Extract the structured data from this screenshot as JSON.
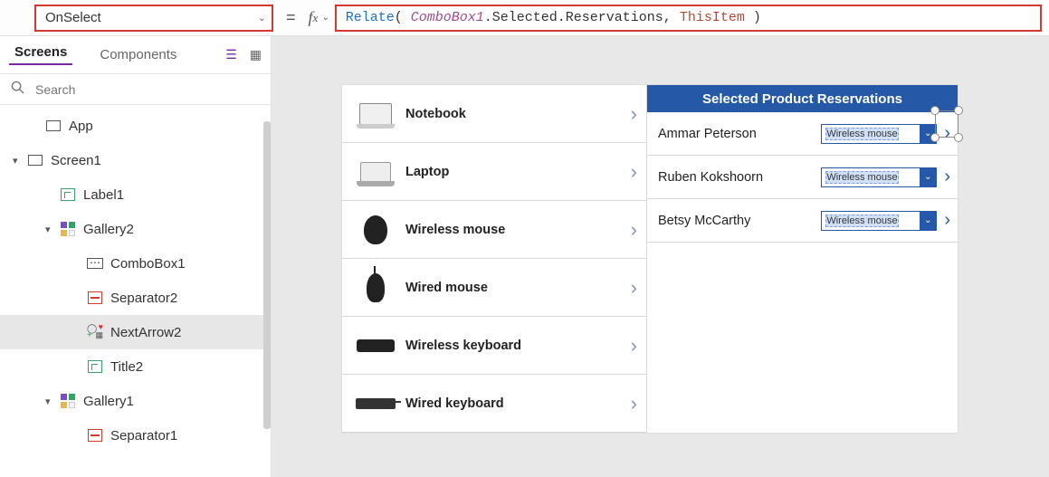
{
  "topbar": {
    "property": "OnSelect",
    "formula_tokens": [
      {
        "t": "fn",
        "v": "Relate"
      },
      {
        "t": "plain",
        "v": "( "
      },
      {
        "t": "var",
        "v": "ComboBox1"
      },
      {
        "t": "prop",
        "v": ".Selected.Reservations"
      },
      {
        "t": "plain",
        "v": ", "
      },
      {
        "t": "this",
        "v": "ThisItem"
      },
      {
        "t": "plain",
        "v": " )"
      }
    ]
  },
  "leftpanel": {
    "tabs": {
      "screens": "Screens",
      "components": "Components"
    },
    "search_placeholder": "Search",
    "tree": [
      {
        "id": "app",
        "label": "App",
        "icon": "square",
        "indent": 0,
        "caret": "",
        "interact": true
      },
      {
        "id": "screen1",
        "label": "Screen1",
        "icon": "screen",
        "indent": 0,
        "caret": "▾",
        "interact": true
      },
      {
        "id": "label1",
        "label": "Label1",
        "icon": "label",
        "indent": 1,
        "caret": "",
        "interact": true
      },
      {
        "id": "gallery2",
        "label": "Gallery2",
        "icon": "gallery",
        "indent": 1,
        "caret": "▾",
        "interact": true
      },
      {
        "id": "combobox1",
        "label": "ComboBox1",
        "icon": "combo",
        "indent": 2,
        "caret": "",
        "interact": true
      },
      {
        "id": "separator2",
        "label": "Separator2",
        "icon": "sep",
        "indent": 2,
        "caret": "",
        "interact": true
      },
      {
        "id": "nextarrow2",
        "label": "NextArrow2",
        "icon": "arrow",
        "indent": 2,
        "caret": "",
        "interact": true,
        "selected": true
      },
      {
        "id": "title2",
        "label": "Title2",
        "icon": "label",
        "indent": 2,
        "caret": "",
        "interact": true
      },
      {
        "id": "gallery1",
        "label": "Gallery1",
        "icon": "gallery",
        "indent": 1,
        "caret": "▾",
        "interact": true
      },
      {
        "id": "separator1",
        "label": "Separator1",
        "icon": "sep",
        "indent": 2,
        "caret": "",
        "interact": true
      }
    ]
  },
  "canvas": {
    "products": [
      {
        "name": "Notebook",
        "thumb": "notebook"
      },
      {
        "name": "Laptop",
        "thumb": "laptop"
      },
      {
        "name": "Wireless mouse",
        "thumb": "wmouse"
      },
      {
        "name": "Wired mouse",
        "thumb": "mouse"
      },
      {
        "name": "Wireless keyboard",
        "thumb": "wkbd"
      },
      {
        "name": "Wired keyboard",
        "thumb": "kbd"
      }
    ],
    "reservations": {
      "title": "Selected Product Reservations",
      "rows": [
        {
          "name": "Ammar Peterson",
          "combo": "Wireless mouse",
          "selected": true
        },
        {
          "name": "Ruben Kokshoorn",
          "combo": "Wireless mouse",
          "selected": false
        },
        {
          "name": "Betsy McCarthy",
          "combo": "Wireless mouse",
          "selected": false
        }
      ]
    }
  }
}
